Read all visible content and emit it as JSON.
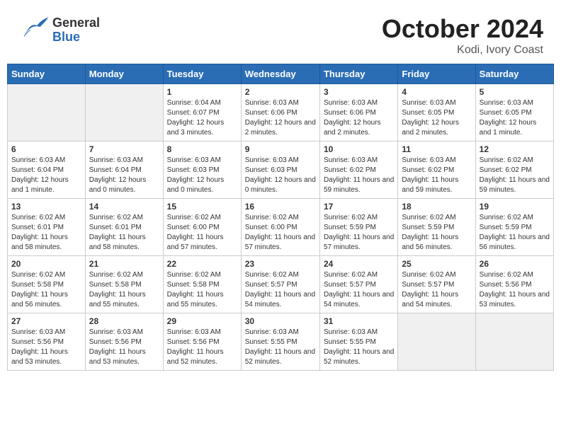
{
  "header": {
    "logo_general": "General",
    "logo_blue": "Blue",
    "month": "October 2024",
    "location": "Kodi, Ivory Coast"
  },
  "weekdays": [
    "Sunday",
    "Monday",
    "Tuesday",
    "Wednesday",
    "Thursday",
    "Friday",
    "Saturday"
  ],
  "weeks": [
    [
      {
        "day": "",
        "info": ""
      },
      {
        "day": "",
        "info": ""
      },
      {
        "day": "1",
        "info": "Sunrise: 6:04 AM\nSunset: 6:07 PM\nDaylight: 12 hours and 3 minutes."
      },
      {
        "day": "2",
        "info": "Sunrise: 6:03 AM\nSunset: 6:06 PM\nDaylight: 12 hours and 2 minutes."
      },
      {
        "day": "3",
        "info": "Sunrise: 6:03 AM\nSunset: 6:06 PM\nDaylight: 12 hours and 2 minutes."
      },
      {
        "day": "4",
        "info": "Sunrise: 6:03 AM\nSunset: 6:05 PM\nDaylight: 12 hours and 2 minutes."
      },
      {
        "day": "5",
        "info": "Sunrise: 6:03 AM\nSunset: 6:05 PM\nDaylight: 12 hours and 1 minute."
      }
    ],
    [
      {
        "day": "6",
        "info": "Sunrise: 6:03 AM\nSunset: 6:04 PM\nDaylight: 12 hours and 1 minute."
      },
      {
        "day": "7",
        "info": "Sunrise: 6:03 AM\nSunset: 6:04 PM\nDaylight: 12 hours and 0 minutes."
      },
      {
        "day": "8",
        "info": "Sunrise: 6:03 AM\nSunset: 6:03 PM\nDaylight: 12 hours and 0 minutes."
      },
      {
        "day": "9",
        "info": "Sunrise: 6:03 AM\nSunset: 6:03 PM\nDaylight: 12 hours and 0 minutes."
      },
      {
        "day": "10",
        "info": "Sunrise: 6:03 AM\nSunset: 6:02 PM\nDaylight: 11 hours and 59 minutes."
      },
      {
        "day": "11",
        "info": "Sunrise: 6:03 AM\nSunset: 6:02 PM\nDaylight: 11 hours and 59 minutes."
      },
      {
        "day": "12",
        "info": "Sunrise: 6:02 AM\nSunset: 6:02 PM\nDaylight: 11 hours and 59 minutes."
      }
    ],
    [
      {
        "day": "13",
        "info": "Sunrise: 6:02 AM\nSunset: 6:01 PM\nDaylight: 11 hours and 58 minutes."
      },
      {
        "day": "14",
        "info": "Sunrise: 6:02 AM\nSunset: 6:01 PM\nDaylight: 11 hours and 58 minutes."
      },
      {
        "day": "15",
        "info": "Sunrise: 6:02 AM\nSunset: 6:00 PM\nDaylight: 11 hours and 57 minutes."
      },
      {
        "day": "16",
        "info": "Sunrise: 6:02 AM\nSunset: 6:00 PM\nDaylight: 11 hours and 57 minutes."
      },
      {
        "day": "17",
        "info": "Sunrise: 6:02 AM\nSunset: 5:59 PM\nDaylight: 11 hours and 57 minutes."
      },
      {
        "day": "18",
        "info": "Sunrise: 6:02 AM\nSunset: 5:59 PM\nDaylight: 11 hours and 56 minutes."
      },
      {
        "day": "19",
        "info": "Sunrise: 6:02 AM\nSunset: 5:59 PM\nDaylight: 11 hours and 56 minutes."
      }
    ],
    [
      {
        "day": "20",
        "info": "Sunrise: 6:02 AM\nSunset: 5:58 PM\nDaylight: 11 hours and 56 minutes."
      },
      {
        "day": "21",
        "info": "Sunrise: 6:02 AM\nSunset: 5:58 PM\nDaylight: 11 hours and 55 minutes."
      },
      {
        "day": "22",
        "info": "Sunrise: 6:02 AM\nSunset: 5:58 PM\nDaylight: 11 hours and 55 minutes."
      },
      {
        "day": "23",
        "info": "Sunrise: 6:02 AM\nSunset: 5:57 PM\nDaylight: 11 hours and 54 minutes."
      },
      {
        "day": "24",
        "info": "Sunrise: 6:02 AM\nSunset: 5:57 PM\nDaylight: 11 hours and 54 minutes."
      },
      {
        "day": "25",
        "info": "Sunrise: 6:02 AM\nSunset: 5:57 PM\nDaylight: 11 hours and 54 minutes."
      },
      {
        "day": "26",
        "info": "Sunrise: 6:02 AM\nSunset: 5:56 PM\nDaylight: 11 hours and 53 minutes."
      }
    ],
    [
      {
        "day": "27",
        "info": "Sunrise: 6:03 AM\nSunset: 5:56 PM\nDaylight: 11 hours and 53 minutes."
      },
      {
        "day": "28",
        "info": "Sunrise: 6:03 AM\nSunset: 5:56 PM\nDaylight: 11 hours and 53 minutes."
      },
      {
        "day": "29",
        "info": "Sunrise: 6:03 AM\nSunset: 5:56 PM\nDaylight: 11 hours and 52 minutes."
      },
      {
        "day": "30",
        "info": "Sunrise: 6:03 AM\nSunset: 5:55 PM\nDaylight: 11 hours and 52 minutes."
      },
      {
        "day": "31",
        "info": "Sunrise: 6:03 AM\nSunset: 5:55 PM\nDaylight: 11 hours and 52 minutes."
      },
      {
        "day": "",
        "info": ""
      },
      {
        "day": "",
        "info": ""
      }
    ]
  ]
}
